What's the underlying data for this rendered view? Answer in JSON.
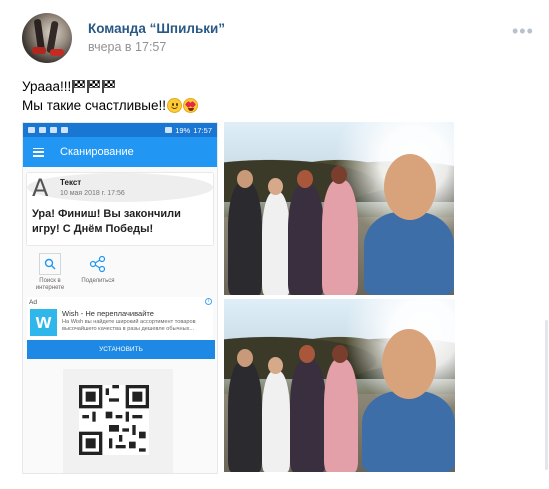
{
  "post": {
    "author": "Команда “Шпильки”",
    "time": "вчера в 17:57",
    "text_line1": "Урааа!!!",
    "text_line2": "Мы такие счастливые!!",
    "more_icon": "more-horizontal-icon"
  },
  "screenshot": {
    "status_time": "17:57",
    "battery": "19%",
    "app_title": "Сканирование",
    "result_type": "Текст",
    "result_date": "10 мая 2018 г. 17:56",
    "result_text": "Ура! Финиш! Вы закончили игру! С Днём Победы!",
    "action_search": "Поиск в интернете",
    "action_share": "Поделиться",
    "ad_label": "Ad",
    "ad_logo": "w",
    "ad_title": "Wish - Не переплачивайте",
    "ad_desc": "На Wish вы найдете широкий ассортимент товаров высочайшего качества в разы дешевле обычных...",
    "ad_install": "УСТАНОВИТЬ"
  },
  "colors": {
    "link": "#2a5885",
    "accent": "#2196f3",
    "time": "#939393"
  }
}
